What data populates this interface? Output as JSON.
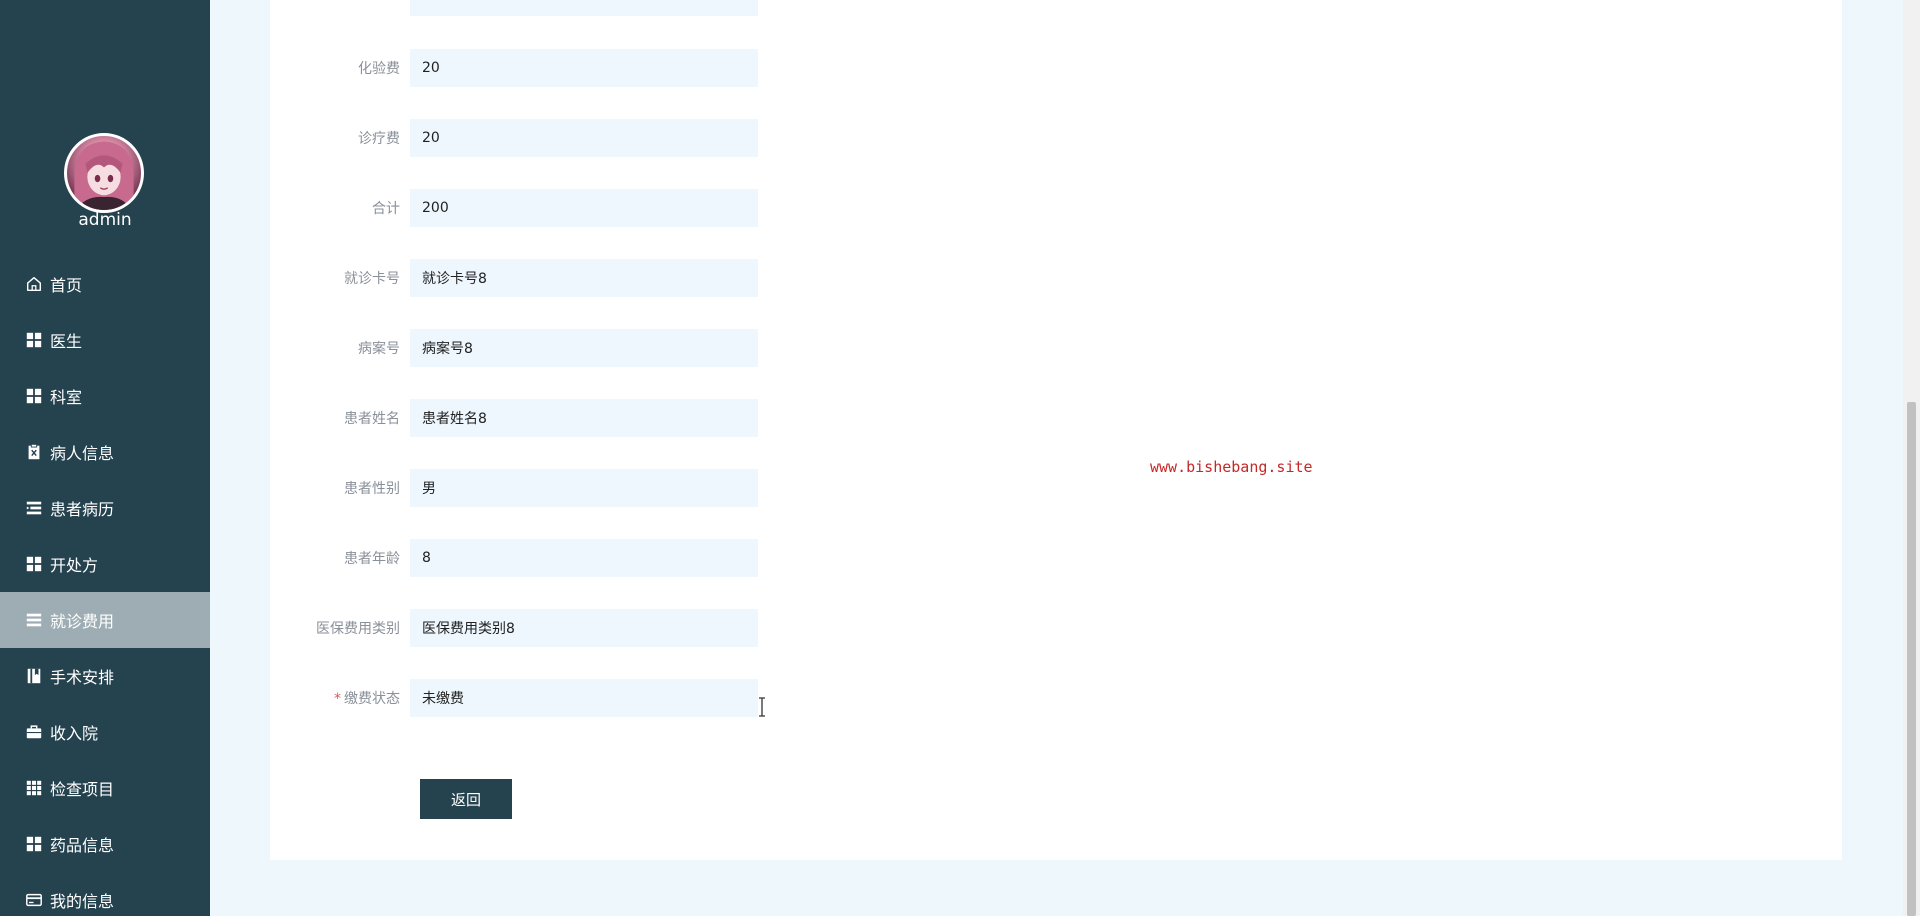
{
  "sidebar": {
    "username": "admin",
    "items": [
      {
        "label": "首页",
        "icon": "home-icon"
      },
      {
        "label": "医生",
        "icon": "grid-icon"
      },
      {
        "label": "科室",
        "icon": "grid-icon"
      },
      {
        "label": "病人信息",
        "icon": "clipboard-icon"
      },
      {
        "label": "患者病历",
        "icon": "list-icon"
      },
      {
        "label": "开处方",
        "icon": "grid-icon"
      },
      {
        "label": "就诊费用",
        "icon": "list-icon",
        "active": true
      },
      {
        "label": "手术安排",
        "icon": "book-icon"
      },
      {
        "label": "收入院",
        "icon": "briefcase-icon"
      },
      {
        "label": "检查项目",
        "icon": "apps-icon"
      },
      {
        "label": "药品信息",
        "icon": "grid-icon"
      },
      {
        "label": "我的信息",
        "icon": "card-icon"
      }
    ]
  },
  "form": {
    "fields": [
      {
        "label": "化验费",
        "value": "20"
      },
      {
        "label": "诊疗费",
        "value": "20"
      },
      {
        "label": "合计",
        "value": "200"
      },
      {
        "label": "就诊卡号",
        "value": "就诊卡号8"
      },
      {
        "label": "病案号",
        "value": "病案号8"
      },
      {
        "label": "患者姓名",
        "value": "患者姓名8"
      },
      {
        "label": "患者性别",
        "value": "男"
      },
      {
        "label": "患者年龄",
        "value": "8"
      },
      {
        "label": "医保费用类别",
        "value": "医保费用类别8"
      },
      {
        "label": "缴费状态",
        "value": "未缴费",
        "required": true
      }
    ],
    "back_label": "返回"
  },
  "watermark": "www.bishebang.site",
  "colors": {
    "sidebar_bg": "#25424f",
    "active_bg": "#9eadb4",
    "input_bg": "#eef7fd",
    "button_bg": "#25424f",
    "watermark": "#c62828"
  }
}
